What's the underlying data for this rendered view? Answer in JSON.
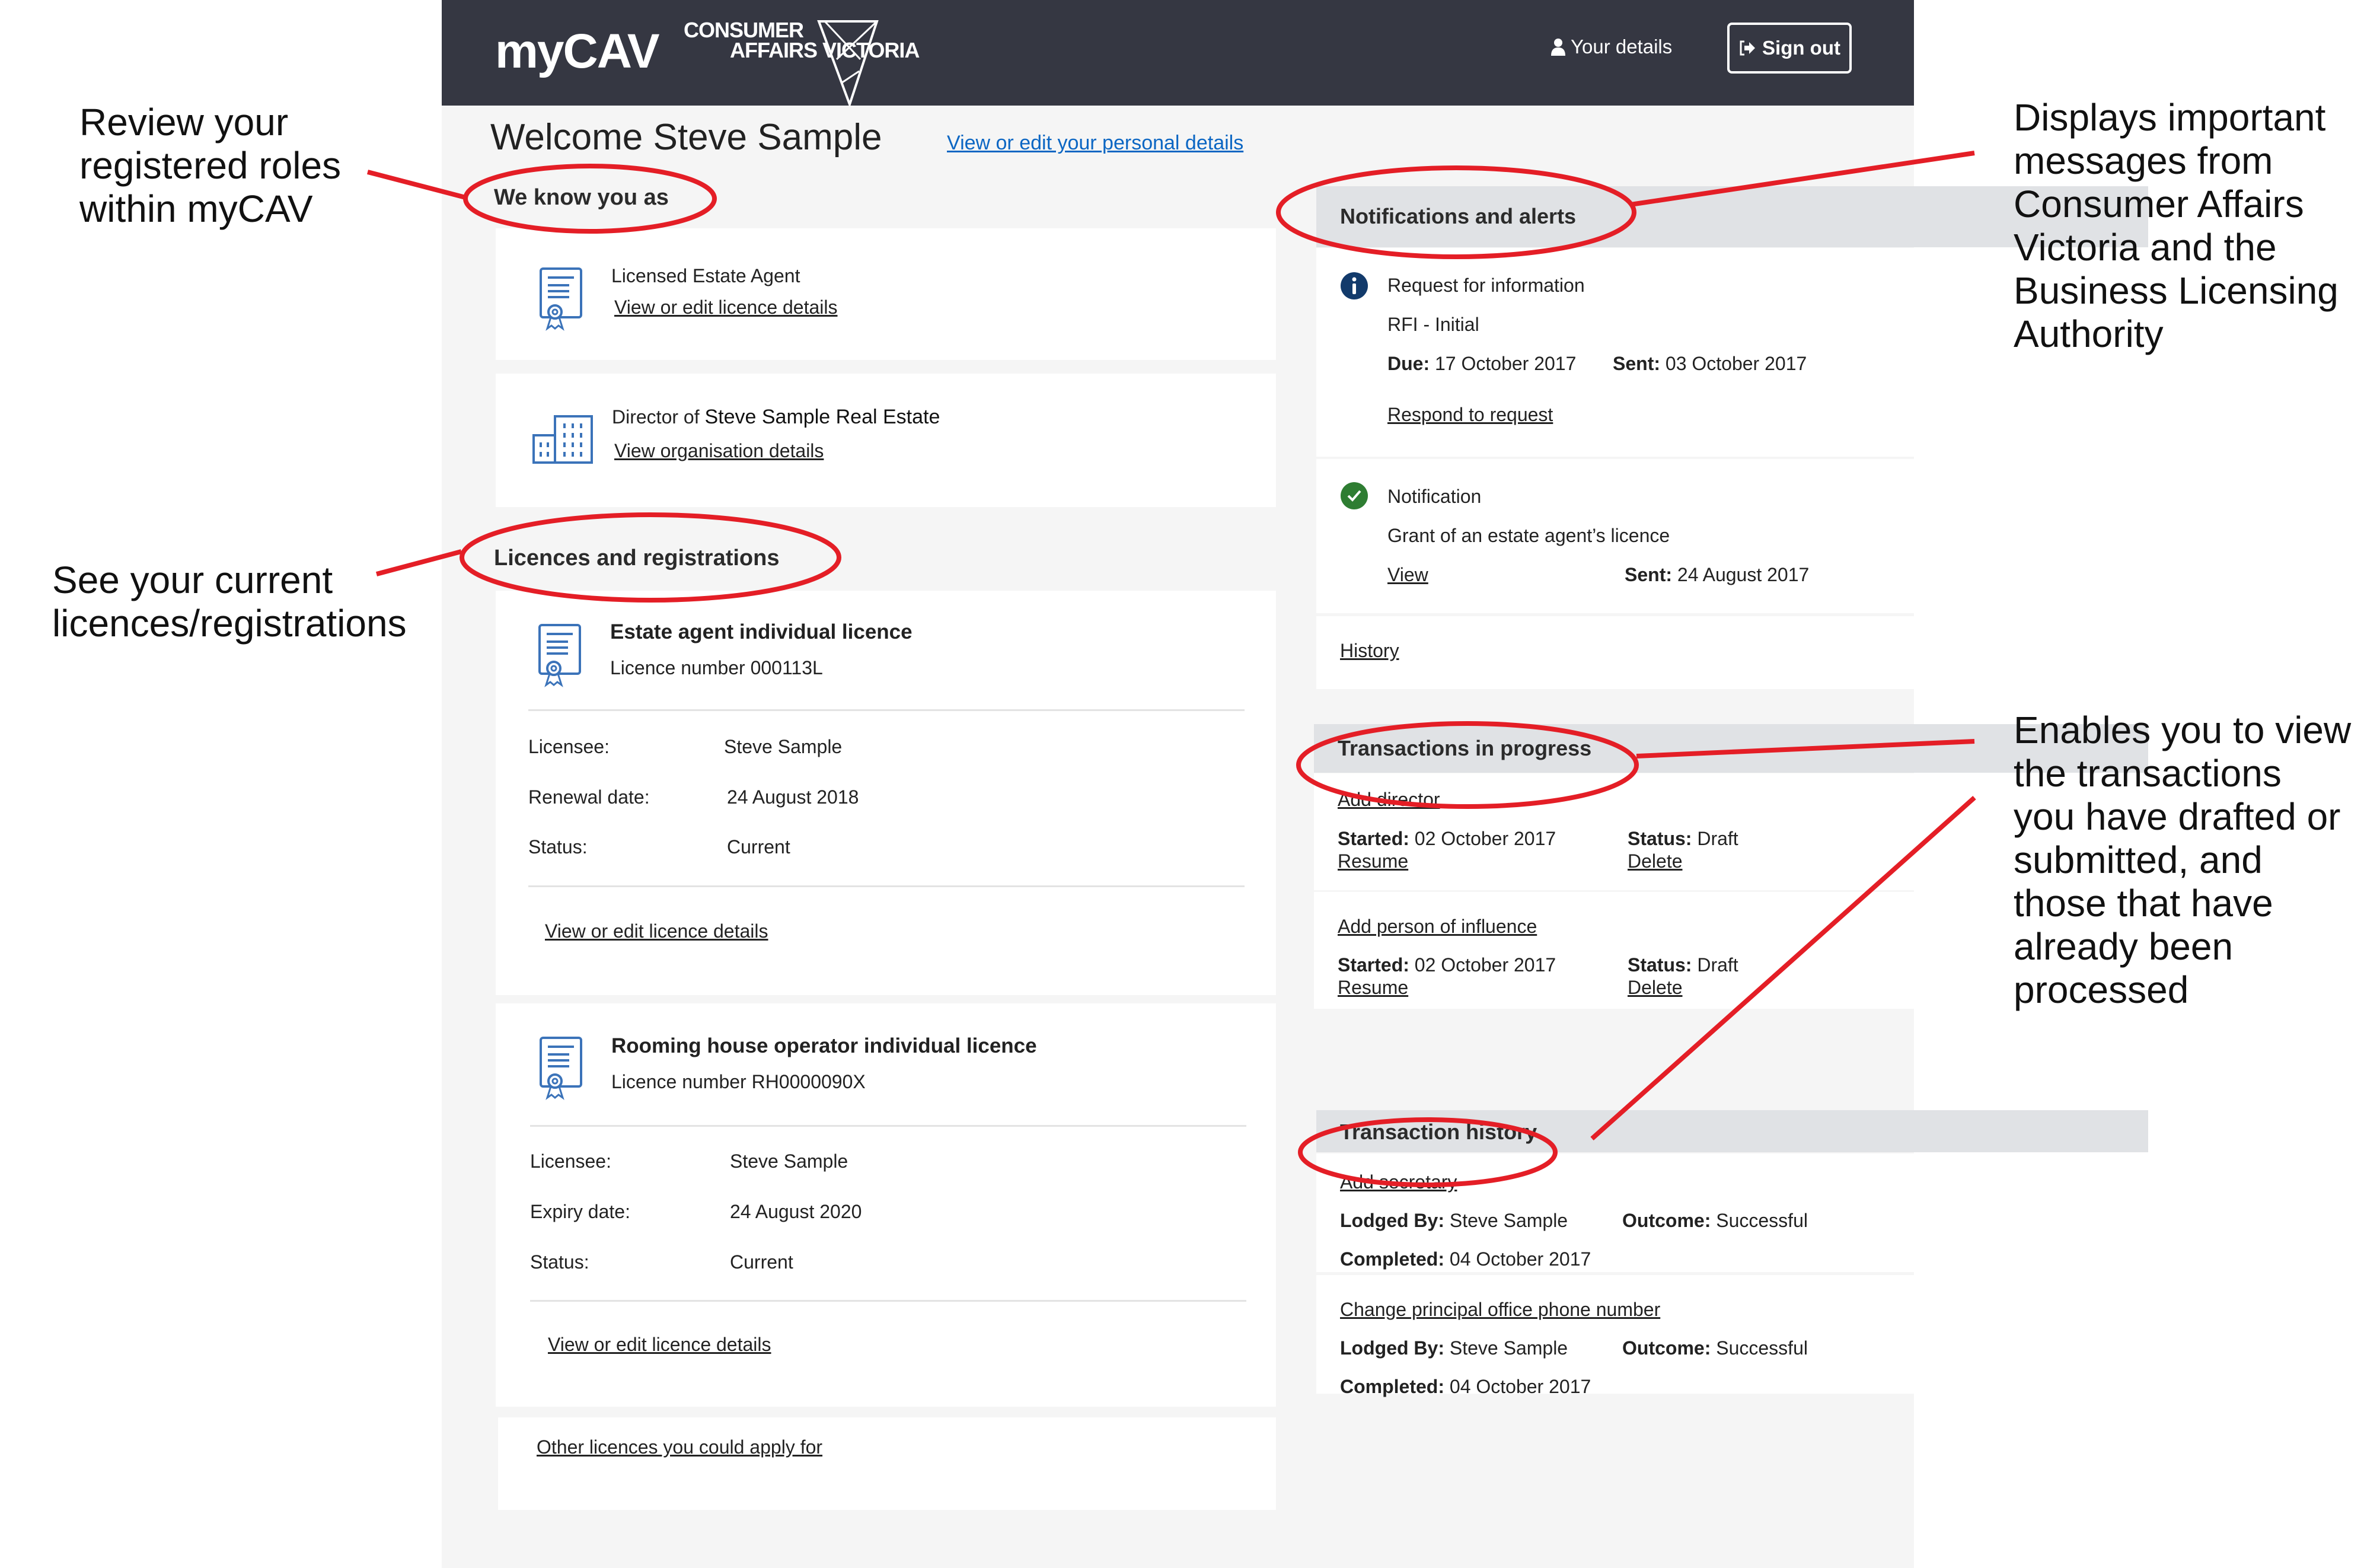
{
  "header": {
    "app_name": "myCAV",
    "org_logo_line1": "CONSUMER",
    "org_logo_line2": "AFFAIRS VICTORIA",
    "your_details_label": "Your details",
    "sign_out_label": "Sign out"
  },
  "welcome": {
    "title": "Welcome Steve Sample",
    "personal_details_link": "View or edit your personal details"
  },
  "we_know_you_as": {
    "title": "We know you as",
    "roles": [
      {
        "label": "Licensed Estate Agent",
        "link": "View or edit licence details",
        "icon": "certificate-icon"
      },
      {
        "prefix": "Director of",
        "label": "Steve Sample Real Estate",
        "link": "View organisation details",
        "icon": "building-icon"
      }
    ]
  },
  "licences": {
    "title": "Licences and registrations",
    "items": [
      {
        "name": "Estate agent individual licence",
        "number_label": "Licence number 000113L",
        "fields": [
          {
            "label": "Licensee:",
            "value": "Steve Sample"
          },
          {
            "label": "Renewal date:",
            "value": "24 August 2018"
          },
          {
            "label": "Status:",
            "value": "Current"
          }
        ],
        "link": "View or edit licence details"
      },
      {
        "name": "Rooming house operator individual licence",
        "number_label": "Licence number RH0000090X",
        "fields": [
          {
            "label": "Licensee:",
            "value": "Steve Sample"
          },
          {
            "label": "Expiry date:",
            "value": "24 August 2020"
          },
          {
            "label": "Status:",
            "value": "Current"
          }
        ],
        "link": "View or edit licence details"
      }
    ],
    "other_link": "Other licences you could apply for"
  },
  "notifications": {
    "title": "Notifications and alerts",
    "items": [
      {
        "icon": "info-icon",
        "title": "Request for information",
        "subtitle": "RFI - Initial",
        "due_label": "Due:",
        "due_value": "17 October 2017",
        "sent_label": "Sent:",
        "sent_value": "03 October 2017",
        "link": "Respond to request"
      },
      {
        "icon": "check-circle-icon",
        "title": "Notification",
        "subtitle": "Grant of an estate agent’s licence",
        "link": "View",
        "sent_label": "Sent:",
        "sent_value": "24 August 2017"
      }
    ],
    "history_link": "History"
  },
  "transactions_in_progress": {
    "title": "Transactions in progress",
    "items": [
      {
        "name": "Add director",
        "started_label": "Started:",
        "started_value": "02 October 2017",
        "status_label": "Status:",
        "status_value": "Draft",
        "resume": "Resume",
        "delete": "Delete"
      },
      {
        "name": "Add person of influence",
        "started_label": "Started:",
        "started_value": "02 October 2017",
        "status_label": "Status:",
        "status_value": "Draft",
        "resume": "Resume",
        "delete": "Delete"
      }
    ]
  },
  "transaction_history": {
    "title": "Transaction history",
    "items": [
      {
        "name": "Add secretary",
        "lodged_label": "Lodged By:",
        "lodged_value": "Steve Sample",
        "outcome_label": "Outcome:",
        "outcome_value": "Successful",
        "completed_label": "Completed:",
        "completed_value": "04 October 2017"
      },
      {
        "name": "Change principal office phone number",
        "lodged_label": "Lodged By:",
        "lodged_value": "Steve Sample",
        "outcome_label": "Outcome:",
        "outcome_value": "Successful",
        "completed_label": "Completed:",
        "completed_value": "04 October 2017"
      }
    ]
  },
  "annotations": {
    "roles": [
      "Review your",
      "registered roles",
      "within myCAV"
    ],
    "licences": [
      "See your current",
      "licences/registrations"
    ],
    "notifications": [
      "Displays important",
      "messages from",
      "Consumer Affairs",
      "Victoria and the",
      "Business Licensing",
      "Authority"
    ],
    "transactions": [
      "Enables you to view",
      "the transactions",
      "you have drafted or",
      "submitted, and",
      "those that have",
      "already been",
      "processed"
    ]
  },
  "colors": {
    "header_bg": "#353742",
    "page_bg": "#f5f5f5",
    "link": "#0b66c3",
    "panel_head_bg": "#e0e2e5",
    "info_icon": "#123a6b",
    "success_icon": "#2e7d32",
    "annotation_red": "#e41e26",
    "icon_blue": "#3b73b9"
  }
}
